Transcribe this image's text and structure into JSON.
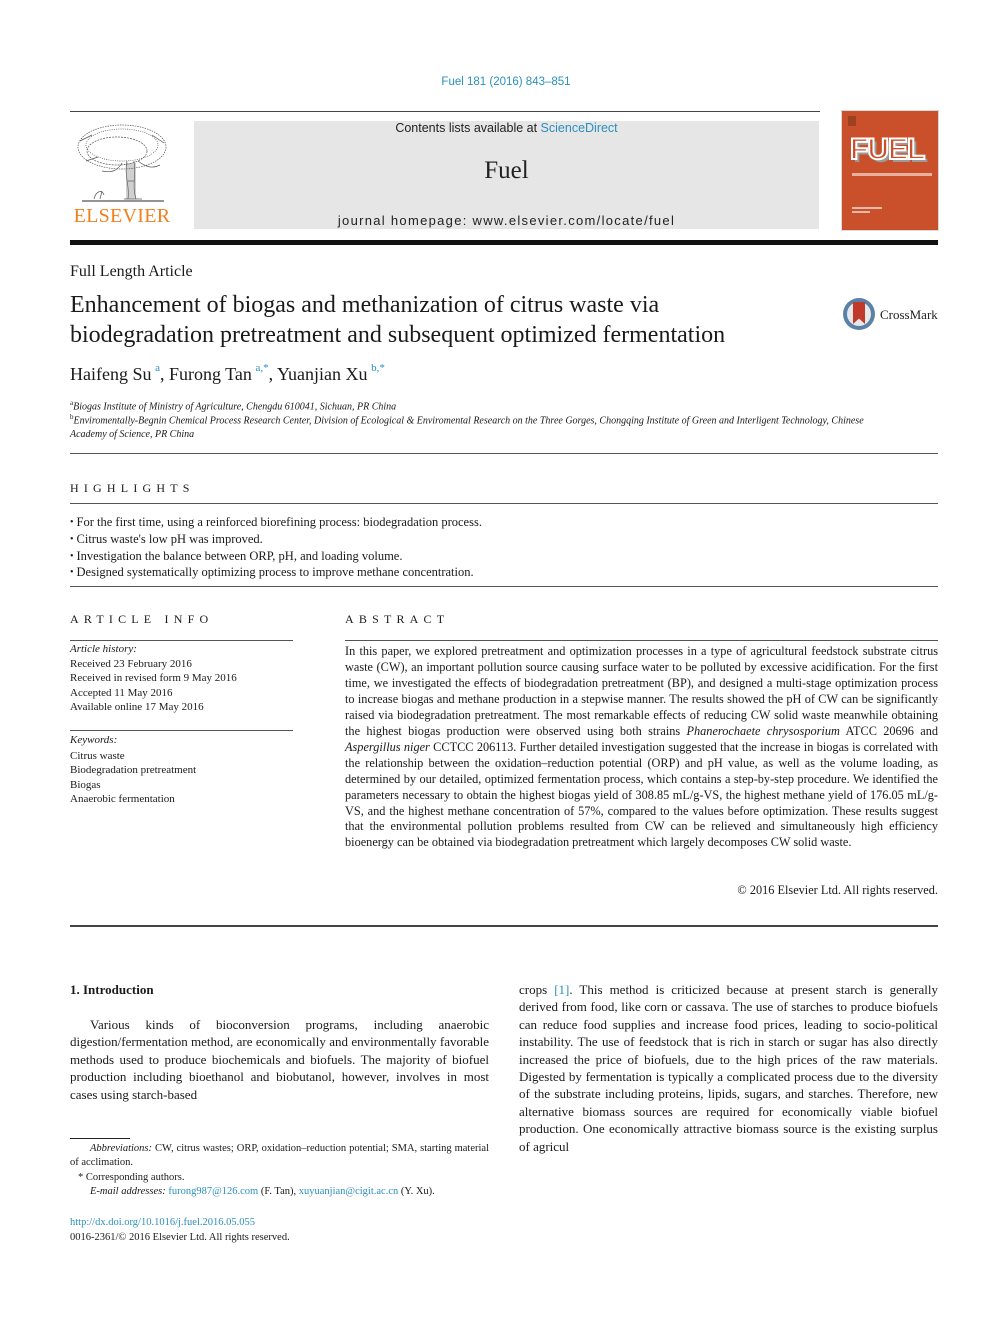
{
  "header": {
    "citation": "Fuel 181 (2016) 843–851",
    "publisher_logo_text": "ELSEVIER",
    "contents_prefix": "Contents lists available at ",
    "contents_link": "ScienceDirect",
    "journal_name": "Fuel",
    "homepage": "journal homepage: www.elsevier.com/locate/fuel",
    "cover_title": "FUEL",
    "crossmark_label": "CrossMark"
  },
  "colors": {
    "link": "#2a8fbd",
    "elsevier_orange": "#f0801e",
    "cover_bg": "#c9502a",
    "banner_bg": "#e6e6e6"
  },
  "article": {
    "type": "Full Length Article",
    "title_line1": "Enhancement of biogas and methanization of citrus waste via",
    "title_line2": "biodegradation pretreatment and subsequent optimized fermentation",
    "authors": [
      {
        "name": "Haifeng Su",
        "sup": "a"
      },
      {
        "name": "Furong Tan",
        "sup": "a,*"
      },
      {
        "name": "Yuanjian Xu",
        "sup": "b,*"
      }
    ],
    "affiliations": [
      {
        "key": "a",
        "text": "Biogas Institute of Ministry of Agriculture, Chengdu 610041, Sichuan, PR China"
      },
      {
        "key": "b",
        "text": "Enviromentally-Begnin Chemical Process Research Center, Division of Ecological & Enviromental Research on the Three Gorges, Chongqing Institute of Green and Interligent Technology, Chinese Academy of Science, PR China"
      }
    ]
  },
  "highlights": {
    "heading": "HIGHLIGHTS",
    "items": [
      "For the first time, using a reinforced biorefining process: biodegradation process.",
      "Citrus waste's low pH was improved.",
      "Investigation the balance between ORP, pH, and loading volume.",
      "Designed systematically optimizing process to improve methane concentration."
    ]
  },
  "article_info": {
    "heading": "ARTICLE INFO",
    "history_label": "Article history:",
    "history": [
      "Received 23 February 2016",
      "Received in revised form 9 May 2016",
      "Accepted 11 May 2016",
      "Available online 17 May 2016"
    ],
    "keywords_label": "Keywords:",
    "keywords": [
      "Citrus waste",
      "Biodegradation pretreatment",
      "Biogas",
      "Anaerobic fermentation"
    ]
  },
  "abstract": {
    "heading": "ABSTRACT",
    "part1": "In this paper, we explored pretreatment and optimization processes in a type of agricultural feedstock substrate citrus waste (CW), an important pollution source causing surface water to be polluted by exces­sive acidification. For the first time, we investigated the effects of biodegradation pretreatment (BP), and designed a multi-stage optimization process to increase biogas and methane production in a stepwise manner. The results showed the pH of CW can be significantly raised via biodegradation pretreatment. The most remarkable effects of reducing CW solid waste meanwhile obtaining the highest biogas produc­tion were observed using both strains ",
    "species1": "Phanerochaete chrysosporium",
    "part2": " ATCC 20696 and ",
    "species2": "Aspergillus niger",
    "part3": " CCTCC 206113. Further detailed investigation suggested that the increase in biogas is correlated with the relationship between the oxidation–reduction potential (ORP) and pH value, as well as the volume loading, as determined by our detailed, optimized fermentation process, which contains a step-by-step procedure. We identified the parameters necessary to obtain the highest biogas yield of 308.85 mL/g-VS, the highest methane yield of 176.05 mL/g-VS, and the highest methane concentration of 57%, com­pared to the values before optimization. These results suggest that the environmental pollution problems resulted from CW can be relieved and simultaneously high efficiency bioenergy can be obtained via biodegradation pretreatment which largely decomposes CW solid waste.",
    "copyright": "© 2016 Elsevier Ltd. All rights reserved."
  },
  "introduction": {
    "heading": "1. Introduction",
    "col1": "Various kinds of bioconversion programs, including anaerobic digestion/fermentation method, are economically and environ­mentally favorable methods used to produce biochemicals and bio­fuels. The majority of biofuel production including bioethanol and biobutanol, however, involves in most cases using starch-based",
    "col2_pre": "crops ",
    "col2_ref": "[1]",
    "col2_post": ". This method is criticized because at present starch is generally derived from food, like corn or cassava. The use of starches to produce biofuels can reduce food supplies and increase food prices, leading to socio-political instability. The use of feed­stock that is rich in starch or sugar has also directly increased the price of biofuels, due to the high prices of the raw materials. Digested by fermentation is typically a complicated process due to the diversity of the substrate including proteins, lipids, sugars, and starches. Therefore, new alternative biomass sources are required for economically viable biofuel production. One econom­ically attractive biomass source is the existing surplus of agricul­"
  },
  "footnotes": {
    "abbrev_label": "Abbreviations:",
    "abbrev_text": " CW, citrus wastes; ORP, oxidation–reduction potential; SMA, starting material of acclimation.",
    "corr_mark": "*",
    "corr_text": " Corresponding authors.",
    "email_label": "E-mail addresses:",
    "email1": "furong987@126.com",
    "email1_owner": " (F. Tan), ",
    "email2": "xuyuanjian@cigit.ac.cn",
    "email2_owner": " (Y. Xu).",
    "doi": "http://dx.doi.org/10.1016/j.fuel.2016.05.055",
    "issn": "0016-2361/© 2016 Elsevier Ltd. All rights reserved."
  }
}
